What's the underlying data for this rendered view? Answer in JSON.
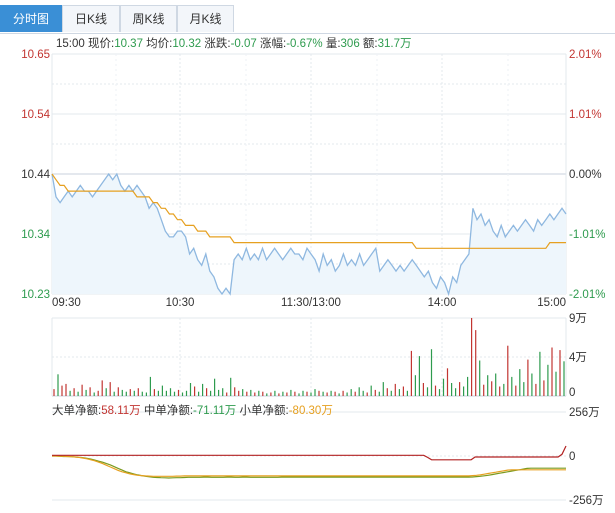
{
  "tabs": [
    {
      "label": "分时图",
      "active": true
    },
    {
      "label": "日K线",
      "active": false
    },
    {
      "label": "周K线",
      "active": false
    },
    {
      "label": "月K线",
      "active": false
    }
  ],
  "info": {
    "time": "15:00",
    "price_label": "现价:",
    "price": "10.37",
    "avg_label": "均价:",
    "avg": "10.32",
    "change_label": "涨跌:",
    "change": "-0.07",
    "pct_label": "涨幅:",
    "pct": "-0.67%",
    "vol_label": "量:",
    "vol": "306",
    "amount_label": "额:",
    "amount": "31.7万"
  },
  "money_flow": {
    "big_label": "大单净额:",
    "big": "58.11万",
    "mid_label": "中单净额:",
    "mid": "-71.11万",
    "small_label": "小单净额:",
    "small": "-80.30万"
  },
  "colors": {
    "price_line": "#8fb8e0",
    "price_fill": "#eef6fc",
    "avg_line": "#e6a020",
    "up": "#c23531",
    "down": "#2e9b4e",
    "mid_flow": "#7a9a1e"
  },
  "chart_data": {
    "type": "line",
    "price_axis": [
      "10.65",
      "10.54",
      "10.44",
      "10.34",
      "10.23"
    ],
    "pct_axis": [
      "2.01%",
      "1.01%",
      "0.00%",
      "-1.01%",
      "-2.01%"
    ],
    "ylim": [
      10.23,
      10.65
    ],
    "ref_price": 10.44,
    "time_ticks": [
      "09:30",
      "10:30",
      "11:30/13:00",
      "14:00",
      "15:00"
    ],
    "price": [
      10.44,
      10.4,
      10.39,
      10.4,
      10.41,
      10.4,
      10.41,
      10.42,
      10.41,
      10.41,
      10.4,
      10.41,
      10.42,
      10.43,
      10.44,
      10.43,
      10.44,
      10.42,
      10.41,
      10.42,
      10.41,
      10.42,
      10.41,
      10.4,
      10.38,
      10.39,
      10.38,
      10.36,
      10.34,
      10.33,
      10.33,
      10.34,
      10.34,
      10.33,
      10.3,
      10.31,
      10.29,
      10.28,
      10.3,
      10.27,
      10.26,
      10.24,
      10.23,
      10.24,
      10.23,
      10.29,
      10.3,
      10.29,
      10.31,
      10.29,
      10.3,
      10.29,
      10.31,
      10.29,
      10.3,
      10.31,
      10.3,
      10.29,
      10.3,
      10.31,
      10.3,
      10.3,
      10.29,
      10.31,
      10.3,
      10.29,
      10.27,
      10.3,
      10.28,
      10.29,
      10.27,
      10.28,
      10.3,
      10.28,
      10.29,
      10.28,
      10.3,
      10.28,
      10.29,
      10.3,
      10.31,
      10.27,
      10.28,
      10.29,
      10.28,
      10.27,
      10.28,
      10.27,
      10.28,
      10.29,
      10.28,
      10.27,
      10.26,
      10.27,
      10.25,
      10.24,
      10.26,
      10.25,
      10.23,
      10.26,
      10.25,
      10.28,
      10.29,
      10.3,
      10.38,
      10.36,
      10.37,
      10.35,
      10.36,
      10.34,
      10.33,
      10.35,
      10.33,
      10.34,
      10.35,
      10.34,
      10.35,
      10.36,
      10.35,
      10.34,
      10.36,
      10.35,
      10.36,
      10.37,
      10.36,
      10.37,
      10.38,
      10.37
    ],
    "avg": [
      10.44,
      10.43,
      10.42,
      10.42,
      10.41,
      10.41,
      10.41,
      10.41,
      10.41,
      10.41,
      10.41,
      10.41,
      10.41,
      10.41,
      10.41,
      10.41,
      10.41,
      10.41,
      10.41,
      10.41,
      10.41,
      10.4,
      10.4,
      10.4,
      10.4,
      10.39,
      10.39,
      10.38,
      10.38,
      10.37,
      10.37,
      10.36,
      10.36,
      10.35,
      10.35,
      10.35,
      10.34,
      10.34,
      10.34,
      10.33,
      10.33,
      10.33,
      10.33,
      10.33,
      10.33,
      10.32,
      10.32,
      10.32,
      10.32,
      10.32,
      10.32,
      10.32,
      10.32,
      10.32,
      10.32,
      10.32,
      10.32,
      10.32,
      10.32,
      10.32,
      10.32,
      10.32,
      10.32,
      10.32,
      10.32,
      10.32,
      10.32,
      10.32,
      10.32,
      10.32,
      10.32,
      10.32,
      10.32,
      10.32,
      10.32,
      10.32,
      10.32,
      10.32,
      10.32,
      10.32,
      10.32,
      10.32,
      10.32,
      10.32,
      10.32,
      10.32,
      10.32,
      10.32,
      10.32,
      10.32,
      10.31,
      10.31,
      10.31,
      10.31,
      10.31,
      10.31,
      10.31,
      10.31,
      10.31,
      10.31,
      10.31,
      10.31,
      10.31,
      10.31,
      10.31,
      10.31,
      10.31,
      10.31,
      10.31,
      10.31,
      10.31,
      10.31,
      10.31,
      10.31,
      10.31,
      10.31,
      10.31,
      10.31,
      10.31,
      10.31,
      10.31,
      10.31,
      10.31,
      10.32,
      10.32,
      10.32,
      10.32,
      10.32
    ],
    "volume_axis": [
      "9万",
      "4万",
      "0"
    ],
    "volume_max": 9,
    "volume_units": "万",
    "volume": [
      {
        "v": 0.8,
        "u": 1
      },
      {
        "v": 2.5,
        "u": 0
      },
      {
        "v": 1.2,
        "u": 1
      },
      {
        "v": 1.4,
        "u": 1
      },
      {
        "v": 0.6,
        "u": 0
      },
      {
        "v": 0.9,
        "u": 1
      },
      {
        "v": 0.5,
        "u": 0
      },
      {
        "v": 1.3,
        "u": 1
      },
      {
        "v": 0.7,
        "u": 0
      },
      {
        "v": 1.0,
        "u": 1
      },
      {
        "v": 0.4,
        "u": 0
      },
      {
        "v": 0.6,
        "u": 1
      },
      {
        "v": 1.8,
        "u": 1
      },
      {
        "v": 0.9,
        "u": 0
      },
      {
        "v": 1.6,
        "u": 1
      },
      {
        "v": 0.5,
        "u": 0
      },
      {
        "v": 1.0,
        "u": 1
      },
      {
        "v": 0.7,
        "u": 0
      },
      {
        "v": 0.5,
        "u": 0
      },
      {
        "v": 0.8,
        "u": 1
      },
      {
        "v": 0.6,
        "u": 0
      },
      {
        "v": 0.9,
        "u": 1
      },
      {
        "v": 0.5,
        "u": 0
      },
      {
        "v": 0.4,
        "u": 0
      },
      {
        "v": 2.2,
        "u": 0
      },
      {
        "v": 0.8,
        "u": 1
      },
      {
        "v": 0.6,
        "u": 0
      },
      {
        "v": 1.2,
        "u": 0
      },
      {
        "v": 0.6,
        "u": 0
      },
      {
        "v": 0.9,
        "u": 0
      },
      {
        "v": 0.5,
        "u": 0
      },
      {
        "v": 0.7,
        "u": 1
      },
      {
        "v": 0.4,
        "u": 0
      },
      {
        "v": 0.6,
        "u": 0
      },
      {
        "v": 1.5,
        "u": 0
      },
      {
        "v": 1.1,
        "u": 1
      },
      {
        "v": 0.5,
        "u": 0
      },
      {
        "v": 1.4,
        "u": 0
      },
      {
        "v": 0.9,
        "u": 1
      },
      {
        "v": 0.6,
        "u": 0
      },
      {
        "v": 2.0,
        "u": 0
      },
      {
        "v": 0.7,
        "u": 0
      },
      {
        "v": 0.9,
        "u": 0
      },
      {
        "v": 0.4,
        "u": 1
      },
      {
        "v": 2.1,
        "u": 0
      },
      {
        "v": 1.0,
        "u": 1
      },
      {
        "v": 0.6,
        "u": 1
      },
      {
        "v": 0.8,
        "u": 0
      },
      {
        "v": 0.5,
        "u": 1
      },
      {
        "v": 0.7,
        "u": 0
      },
      {
        "v": 0.4,
        "u": 1
      },
      {
        "v": 0.6,
        "u": 0
      },
      {
        "v": 0.5,
        "u": 1
      },
      {
        "v": 0.3,
        "u": 0
      },
      {
        "v": 0.4,
        "u": 1
      },
      {
        "v": 0.6,
        "u": 0
      },
      {
        "v": 0.3,
        "u": 1
      },
      {
        "v": 0.5,
        "u": 0
      },
      {
        "v": 0.4,
        "u": 1
      },
      {
        "v": 0.7,
        "u": 0
      },
      {
        "v": 0.5,
        "u": 1
      },
      {
        "v": 0.3,
        "u": 0
      },
      {
        "v": 0.6,
        "u": 0
      },
      {
        "v": 0.5,
        "u": 1
      },
      {
        "v": 0.4,
        "u": 0
      },
      {
        "v": 0.8,
        "u": 0
      },
      {
        "v": 0.6,
        "u": 1
      },
      {
        "v": 0.5,
        "u": 0
      },
      {
        "v": 0.4,
        "u": 1
      },
      {
        "v": 0.6,
        "u": 0
      },
      {
        "v": 0.5,
        "u": 1
      },
      {
        "v": 0.3,
        "u": 0
      },
      {
        "v": 0.6,
        "u": 1
      },
      {
        "v": 0.4,
        "u": 0
      },
      {
        "v": 0.8,
        "u": 0
      },
      {
        "v": 0.5,
        "u": 1
      },
      {
        "v": 1.0,
        "u": 0
      },
      {
        "v": 0.6,
        "u": 0
      },
      {
        "v": 0.4,
        "u": 1
      },
      {
        "v": 1.2,
        "u": 0
      },
      {
        "v": 0.7,
        "u": 1
      },
      {
        "v": 0.5,
        "u": 0
      },
      {
        "v": 1.6,
        "u": 0
      },
      {
        "v": 0.9,
        "u": 1
      },
      {
        "v": 0.6,
        "u": 0
      },
      {
        "v": 1.4,
        "u": 1
      },
      {
        "v": 0.8,
        "u": 0
      },
      {
        "v": 1.1,
        "u": 1
      },
      {
        "v": 0.6,
        "u": 0
      },
      {
        "v": 5.2,
        "u": 1
      },
      {
        "v": 2.4,
        "u": 0
      },
      {
        "v": 4.6,
        "u": 0
      },
      {
        "v": 1.5,
        "u": 1
      },
      {
        "v": 1.0,
        "u": 0
      },
      {
        "v": 5.4,
        "u": 0
      },
      {
        "v": 1.2,
        "u": 1
      },
      {
        "v": 0.8,
        "u": 0
      },
      {
        "v": 2.0,
        "u": 0
      },
      {
        "v": 3.2,
        "u": 1
      },
      {
        "v": 1.5,
        "u": 0
      },
      {
        "v": 0.9,
        "u": 0
      },
      {
        "v": 1.6,
        "u": 1
      },
      {
        "v": 1.1,
        "u": 0
      },
      {
        "v": 2.2,
        "u": 0
      },
      {
        "v": 9.0,
        "u": 1
      },
      {
        "v": 7.6,
        "u": 1
      },
      {
        "v": 4.1,
        "u": 0
      },
      {
        "v": 1.3,
        "u": 1
      },
      {
        "v": 2.4,
        "u": 0
      },
      {
        "v": 1.7,
        "u": 1
      },
      {
        "v": 2.6,
        "u": 0
      },
      {
        "v": 1.1,
        "u": 1
      },
      {
        "v": 1.4,
        "u": 0
      },
      {
        "v": 5.8,
        "u": 1
      },
      {
        "v": 2.2,
        "u": 0
      },
      {
        "v": 1.2,
        "u": 1
      },
      {
        "v": 3.1,
        "u": 0
      },
      {
        "v": 1.6,
        "u": 0
      },
      {
        "v": 4.2,
        "u": 1
      },
      {
        "v": 2.6,
        "u": 0
      },
      {
        "v": 1.4,
        "u": 1
      },
      {
        "v": 5.1,
        "u": 0
      },
      {
        "v": 1.8,
        "u": 1
      },
      {
        "v": 3.6,
        "u": 0
      },
      {
        "v": 5.6,
        "u": 1
      },
      {
        "v": 2.8,
        "u": 0
      },
      {
        "v": 5.3,
        "u": 1
      },
      {
        "v": 4.0,
        "u": 0
      }
    ],
    "flow_axis": [
      "256万",
      "0",
      "-256万"
    ],
    "flow_max": 256,
    "flow_big": [
      4,
      4,
      4,
      4,
      4,
      4,
      4,
      4,
      4,
      4,
      4,
      4,
      4,
      4,
      4,
      4,
      4,
      4,
      4,
      4,
      4,
      4,
      4,
      4,
      4,
      4,
      4,
      4,
      4,
      4,
      4,
      4,
      4,
      4,
      4,
      4,
      4,
      4,
      4,
      4,
      4,
      4,
      4,
      4,
      4,
      4,
      4,
      4,
      4,
      4,
      4,
      4,
      4,
      4,
      4,
      4,
      4,
      4,
      4,
      4,
      4,
      4,
      4,
      4,
      4,
      4,
      4,
      4,
      4,
      4,
      4,
      4,
      4,
      4,
      4,
      4,
      4,
      4,
      4,
      4,
      4,
      4,
      4,
      4,
      4,
      4,
      4,
      4,
      4,
      4,
      4,
      4,
      4,
      4,
      4,
      -8,
      -22,
      -22,
      -22,
      -22,
      -22,
      -22,
      -22,
      -22,
      -22,
      -22,
      -22,
      -6,
      -6,
      -6,
      -6,
      -6,
      -6,
      -6,
      -6,
      -6,
      -6,
      -6,
      -6,
      -6,
      -6,
      -6,
      -6,
      -6,
      -6,
      -6,
      -6,
      -6,
      -6,
      10,
      58
    ],
    "flow_mid": [
      0,
      0,
      -2,
      -3,
      -3,
      -4,
      -6,
      -8,
      -10,
      -14,
      -18,
      -24,
      -30,
      -36,
      -44,
      -52,
      -62,
      -72,
      -82,
      -92,
      -98,
      -104,
      -110,
      -114,
      -118,
      -121,
      -124,
      -125,
      -126,
      -127,
      -128,
      -127,
      -126,
      -126,
      -125,
      -124,
      -124,
      -124,
      -124,
      -123,
      -123,
      -124,
      -124,
      -124,
      -124,
      -123,
      -123,
      -124,
      -124,
      -123,
      -123,
      -124,
      -124,
      -124,
      -124,
      -124,
      -124,
      -124,
      -124,
      -123,
      -123,
      -123,
      -123,
      -123,
      -123,
      -123,
      -123,
      -123,
      -123,
      -123,
      -123,
      -123,
      -123,
      -123,
      -123,
      -123,
      -123,
      -123,
      -123,
      -123,
      -123,
      -123,
      -123,
      -123,
      -123,
      -123,
      -123,
      -123,
      -123,
      -123,
      -123,
      -123,
      -123,
      -123,
      -123,
      -123,
      -123,
      -123,
      -123,
      -123,
      -123,
      -123,
      -123,
      -123,
      -123,
      -123,
      -123,
      -123,
      -122,
      -120,
      -118,
      -115,
      -112,
      -108,
      -104,
      -100,
      -96,
      -92,
      -88,
      -84,
      -80,
      -76,
      -72,
      -71,
      -71,
      -71,
      -71,
      -71,
      -71,
      -71,
      -71,
      -71,
      -71
    ],
    "flow_small": [
      0,
      0,
      -1,
      -2,
      -3,
      -4,
      -6,
      -8,
      -12,
      -16,
      -22,
      -28,
      -36,
      -44,
      -54,
      -64,
      -74,
      -84,
      -92,
      -98,
      -104,
      -108,
      -112,
      -114,
      -116,
      -117,
      -118,
      -118,
      -118,
      -118,
      -118,
      -118,
      -117,
      -117,
      -116,
      -116,
      -116,
      -116,
      -116,
      -116,
      -116,
      -116,
      -116,
      -116,
      -116,
      -116,
      -116,
      -116,
      -116,
      -116,
      -116,
      -116,
      -116,
      -116,
      -116,
      -116,
      -116,
      -116,
      -116,
      -116,
      -116,
      -116,
      -116,
      -116,
      -116,
      -116,
      -116,
      -116,
      -116,
      -116,
      -116,
      -116,
      -116,
      -116,
      -116,
      -116,
      -116,
      -116,
      -116,
      -116,
      -116,
      -116,
      -116,
      -116,
      -116,
      -116,
      -116,
      -116,
      -116,
      -116,
      -116,
      -116,
      -116,
      -116,
      -116,
      -116,
      -116,
      -116,
      -116,
      -116,
      -116,
      -116,
      -116,
      -116,
      -116,
      -116,
      -116,
      -116,
      -114,
      -112,
      -110,
      -106,
      -102,
      -98,
      -94,
      -90,
      -86,
      -82,
      -80,
      -80,
      -80,
      -80,
      -80,
      -80,
      -80,
      -80,
      -80,
      -80,
      -80,
      -80,
      -80,
      -80,
      -80
    ]
  }
}
